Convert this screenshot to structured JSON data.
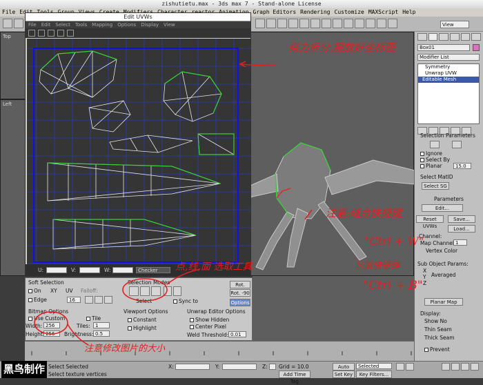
{
  "window": {
    "title": "zishutietu.max - 3ds max 7 - Stand-alone License"
  },
  "menu": [
    "File",
    "Edit",
    "Tools",
    "Group",
    "Views",
    "Create",
    "Modifiers",
    "Character",
    "reactor",
    "Animation",
    "Graph Editors",
    "Rendering",
    "Customize",
    "MAXScript",
    "Help"
  ],
  "toolbar": {
    "view_select": "View"
  },
  "viewports": {
    "top": "Top",
    "left": "Left"
  },
  "uv_editor": {
    "title": "Edit UVWs",
    "menu": [
      "File",
      "Edit",
      "Select",
      "Tools",
      "Mapping",
      "Options",
      "Display",
      "View"
    ],
    "u_label": "U:",
    "v_label": "V:",
    "w_label": "W:",
    "map_dropdown": "Checker",
    "soft_selection": {
      "title": "Soft Selection",
      "on": "On",
      "xy": "XY",
      "uv": "UV",
      "falloff_label": "Falloff:",
      "falloff_value": "16",
      "edge": "Edge"
    },
    "selection_modes": {
      "title": "Selection Modes",
      "select_label": "Select",
      "sync": "Sync to"
    },
    "rotate_plus": "Rot. +90",
    "rotate_minus": "Rot. -90",
    "options_btn": "Options",
    "bitmap_options": {
      "title": "Bitmap Options",
      "use_custom": "Use Custom",
      "tile": "Tile",
      "width_label": "Width:",
      "width_value": "256",
      "height_label": "Height:",
      "height_value": "256",
      "tiles_label": "Tiles:",
      "tiles_value": "1",
      "brightness_label": "Brightness:",
      "brightness_value": "0.5"
    },
    "viewport_options": {
      "title": "Viewport Options",
      "constant": "Constant",
      "highlight": "Highlight"
    },
    "unwrap_options": {
      "title": "Unwrap Editor Options",
      "show_hidden": "Show Hidden",
      "center_pixel": "Center Pixel",
      "weld_label": "Weld Threshold:",
      "weld_value": "0.01"
    }
  },
  "command_panel": {
    "object_name": "Box01",
    "modifier_list": "Modifier List",
    "stack": [
      "Symmetry",
      "Unwrap UVW",
      "Editable Mesh"
    ],
    "selection_params": {
      "title": "Selection Parameters",
      "ignore": "Ignore",
      "select_by": "Select By",
      "planar": "Planar",
      "planar_value": "15.0",
      "select_matid": "Select MatID",
      "select_sg": "Select SG"
    },
    "parameters": {
      "title": "Parameters",
      "edit": "Edit...",
      "reset_uvws": "Reset UVWs",
      "save": "Save...",
      "load": "Load...",
      "channel": "Channel:",
      "map_channel": "Map Channel:",
      "map_value": "1",
      "vertex_color": "Vertex Color",
      "sub_object": "Sub Object Params:",
      "x": "X",
      "y": "Y",
      "z": "Z",
      "averaged": "Averaged",
      "planar_map": "Planar Map"
    },
    "display": {
      "title": "Display:",
      "show_no": "Show No",
      "thin_seam": "Thin Seam",
      "thick_seam": "Thick Seam",
      "prevent": "Prevent"
    }
  },
  "status": {
    "selected": "Select Selected",
    "vertices": "Select texture vertices",
    "x_label": "X:",
    "y_label": "Y:",
    "z_label": "Z:",
    "grid": "Grid = 10.0",
    "auto_key": "Auto Key",
    "selected_dd": "Selected",
    "set_key": "Set Key",
    "key_filters": "Key Filters...",
    "add_time_tag": "Add Time Tag"
  },
  "watermark": "黑鸟制作",
  "annotations": {
    "top": "努力拆分,摆放好坐标图",
    "middle_title": "注意:缝合快捷键",
    "ctrl_w": "\"Ctrl + W\"",
    "split": "分离快捷键",
    "ctrl_b": "\"Ctrl + B\"",
    "tools": "点,线,面 选取工具",
    "bitmap": "注意修改图片的大小"
  }
}
